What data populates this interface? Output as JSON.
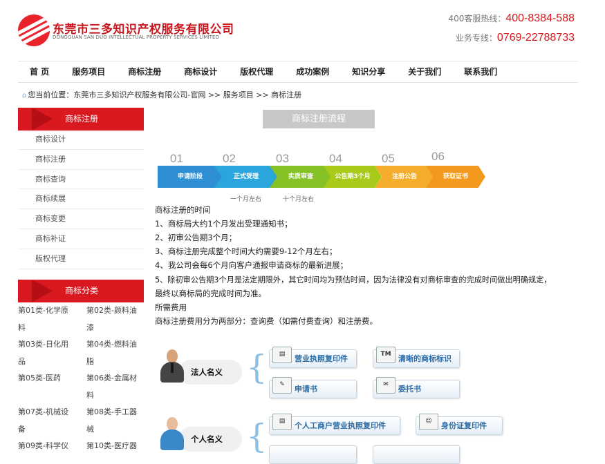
{
  "header": {
    "company_cn": "东莞市三多知识产权服务有限公司",
    "company_en": "DONGGUAN SAN DUO INTELLECTUAL PROPERTY SERVICES LIMITED",
    "hotline_label": "400客服热线：",
    "hotline_number": "400-8384-588",
    "service_label": "业务专线：",
    "service_number": "0769-22788733"
  },
  "nav": [
    "首 页",
    "服务项目",
    "商标注册",
    "商标设计",
    "版权代理",
    "成功案例",
    "知识分享",
    "关于我们",
    "联系我们"
  ],
  "breadcrumb": {
    "prefix": "您当前位置：",
    "path": "东莞市三多知识产权服务有限公司-官网 >> 服务项目 >> 商标注册"
  },
  "sidebar": {
    "menu_title": "商标注册",
    "items": [
      "商标设计",
      "商标注册",
      "商标查询",
      "商标续展",
      "商标变更",
      "商标补证",
      "版权代理"
    ],
    "category_title": "商标分类",
    "categories": [
      "第01类-化学原",
      "第02类-颜料油",
      "料",
      "漆",
      "第03类-日化用",
      "第04类-燃料油",
      "品",
      "脂",
      "第05类-医药",
      "第06类-金属材",
      "",
      "料",
      "第07类-机械设",
      "第08类-手工器",
      "备",
      "械",
      "第09类-科学仪",
      "第10类-医疗器"
    ]
  },
  "content": {
    "flow_title": "商标注册流程",
    "steps": [
      {
        "num": "01",
        "label": "申请阶段",
        "color": "#2f8fd5"
      },
      {
        "num": "02",
        "label": "正式受理",
        "color": "#2aa6dc"
      },
      {
        "num": "03",
        "label": "实质审查",
        "color": "#86c126"
      },
      {
        "num": "04",
        "label": "公告期3个月",
        "color": "#a8ca1a"
      },
      {
        "num": "05",
        "label": "注册公告",
        "color": "#f4ad2a"
      },
      {
        "num": "06",
        "label": "获取证书",
        "color": "#f39a1e"
      }
    ],
    "step_notes": [
      "一个月左右",
      "十个月左右"
    ],
    "paragraphs": [
      "商标注册的时间",
      "1、商标局大约1个月发出受理通知书；",
      "2、初审公告期3个月；",
      "3、商标注册完成整个时间大约需要9-12个月左右；",
      "4、我公司会每6个月向客户通报申请商标的最新进展；",
      "5、除初审公告期3个月是法定期限外，其它时间均为预估时间，因为法律没有对商标审查的完成时间做出明确规定，",
      "最终以商标局的完成时间为准。",
      "所需费用",
      "商标注册费用分为两部分：查询费（如需付费查询）和注册费。"
    ],
    "legal_person_label": "法人名义",
    "legal_docs": [
      "营业执照复印件",
      "清晰的商标标识",
      "申请书",
      "委托书"
    ],
    "individual_label": "个人名义",
    "individual_docs": [
      "个人工商户营业执照复印件",
      "身份证复印件"
    ]
  }
}
